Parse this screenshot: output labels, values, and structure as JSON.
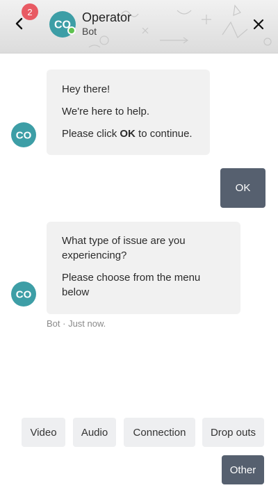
{
  "header": {
    "title": "Operator",
    "subtitle": "Bot",
    "badge_count": "2",
    "avatar_text": "CO",
    "online_color": "#5fc24f"
  },
  "messages": [
    {
      "from": "bot",
      "lines": [
        "Hey there!",
        "We're here to help."
      ],
      "line3_before": "Please click ",
      "line3_bold": "OK",
      "line3_after": " to continue."
    },
    {
      "from": "user",
      "text": "OK"
    },
    {
      "from": "bot",
      "lines": [
        "What type of issue are you experiencing?",
        "Please choose from the menu below"
      ],
      "meta": "Bot · Just now."
    }
  ],
  "quick_replies": [
    "Video",
    "Audio",
    "Connection",
    "Drop outs",
    "Other"
  ],
  "icons": {
    "back": "chevron-left-icon",
    "close": "close-icon"
  },
  "colors": {
    "accent": "#56606f",
    "avatar": "#3d9ea6",
    "badge": "#e85a63",
    "bubble": "#f1f1f1"
  }
}
